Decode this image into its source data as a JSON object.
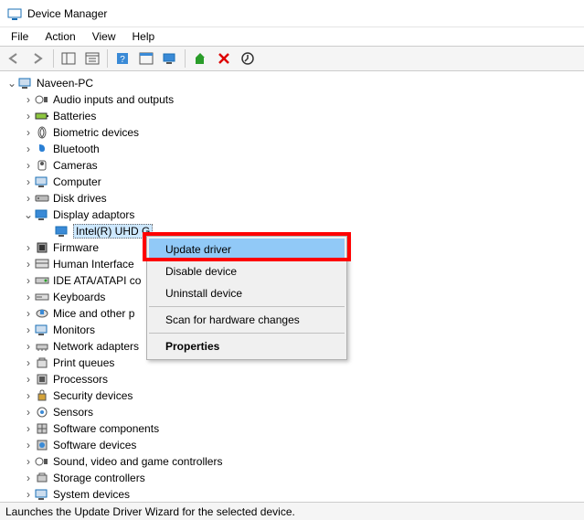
{
  "titlebar": {
    "title": "Device Manager"
  },
  "menubar": {
    "file": "File",
    "action": "Action",
    "view": "View",
    "help": "Help"
  },
  "tree": {
    "root": "Naveen-PC",
    "categories": [
      "Audio inputs and outputs",
      "Batteries",
      "Biometric devices",
      "Bluetooth",
      "Cameras",
      "Computer",
      "Disk drives",
      "Display adaptors",
      "Firmware",
      "Human Interface",
      "IDE ATA/ATAPI co",
      "Keyboards",
      "Mice and other p",
      "Monitors",
      "Network adapters",
      "Print queues",
      "Processors",
      "Security devices",
      "Sensors",
      "Software components",
      "Software devices",
      "Sound, video and game controllers",
      "Storage controllers",
      "System devices"
    ],
    "expanded_index": 7,
    "expanded_child": "Intel(R) UHD G"
  },
  "context_menu": {
    "items": [
      "Update driver",
      "Disable device",
      "Uninstall device",
      "Scan for hardware changes",
      "Properties"
    ],
    "highlighted_index": 0,
    "bold_index": 4
  },
  "statusbar": {
    "text": "Launches the Update Driver Wizard for the selected device."
  }
}
